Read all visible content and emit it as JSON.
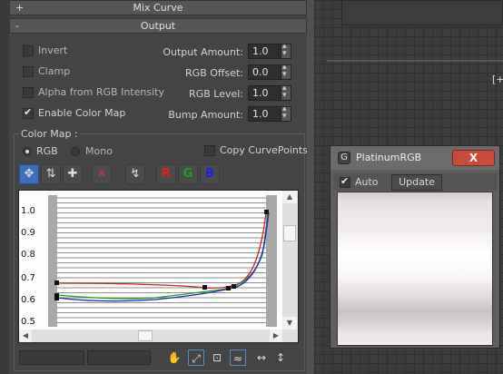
{
  "rollouts": {
    "mix_curve": {
      "label": "Mix Curve",
      "toggle": "+"
    },
    "output": {
      "label": "Output",
      "toggle": "-"
    }
  },
  "output": {
    "checkboxes": [
      {
        "label": "Invert",
        "checked": false
      },
      {
        "label": "Clamp",
        "checked": false
      },
      {
        "label": "Alpha from RGB Intensity",
        "checked": false
      },
      {
        "label": "Enable Color Map",
        "checked": true
      }
    ],
    "spinners": [
      {
        "label": "Output Amount:",
        "value": "1.0"
      },
      {
        "label": "RGB Offset:",
        "value": "0.0"
      },
      {
        "label": "RGB Level:",
        "value": "1.0"
      },
      {
        "label": "Bump Amount:",
        "value": "1.0"
      }
    ]
  },
  "color_map": {
    "group_label": "Color Map :",
    "radio_rgb": "RGB",
    "radio_mono": "Mono",
    "selected": "RGB",
    "copy_curve_points": "Copy CurvePoints",
    "copy_checked": false,
    "toolbar": [
      {
        "icon": "move-icon"
      },
      {
        "icon": "scale-point-icon"
      },
      {
        "icon": "add-point-icon"
      },
      {
        "icon": "delete-point-icon"
      },
      {
        "icon": "reset-curve-icon"
      },
      {
        "icon": "red-channel",
        "label": "R",
        "color": "#e02020"
      },
      {
        "icon": "green-channel",
        "label": "G",
        "color": "#20a020"
      },
      {
        "icon": "blue-channel",
        "label": "B",
        "color": "#2020e0"
      }
    ],
    "y_ticks": [
      "1.0",
      "0.9",
      "0.8",
      "0.7",
      "0.6",
      "0.5"
    ],
    "curve_colors": {
      "red": "#d02020",
      "green": "#20a020",
      "blue": "#2020c0"
    }
  },
  "window": {
    "title": "PlatinumRGB",
    "close": "X",
    "auto_label": "Auto",
    "auto_checked": true,
    "update_label": "Update"
  },
  "viewport": {
    "label": "[+"
  },
  "bottom_tools": [
    {
      "icon": "pan-icon"
    },
    {
      "icon": "zoom-extents-icon"
    },
    {
      "icon": "zoom-region-icon"
    },
    {
      "icon": "zoom-horizontal-icon"
    },
    {
      "icon": "zoom-vertical-icon"
    }
  ]
}
